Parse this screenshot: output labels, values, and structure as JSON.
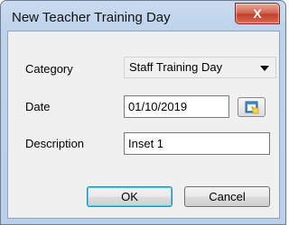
{
  "dialog": {
    "title": "New Teacher Training Day",
    "close_label": "X"
  },
  "form": {
    "category": {
      "label": "Category",
      "value": "Staff Training Day"
    },
    "date": {
      "label": "Date",
      "value": "01/10/2019",
      "calendar_icon": "calendar-icon"
    },
    "description": {
      "label": "Description",
      "value": "Inset 1"
    }
  },
  "buttons": {
    "ok": "OK",
    "cancel": "Cancel"
  },
  "colors": {
    "frame": "#bfd3ec",
    "client": "#f0f0f0",
    "close_button": "#c2402b"
  }
}
